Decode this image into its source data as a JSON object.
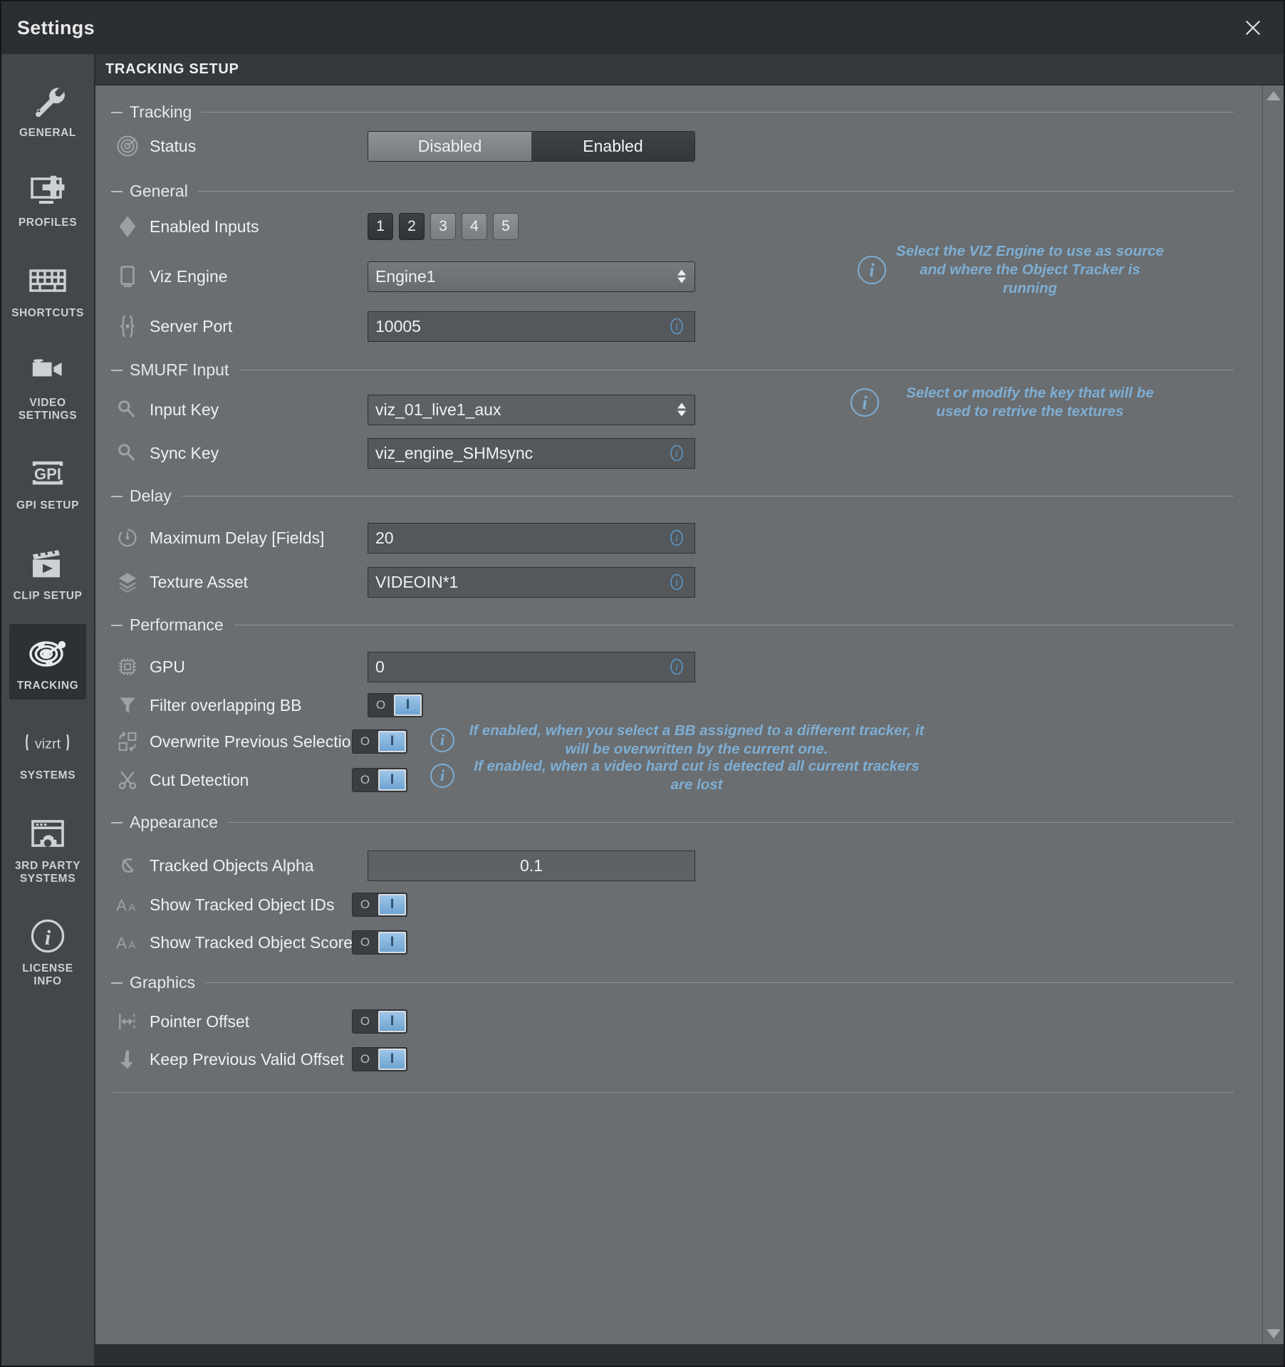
{
  "window": {
    "title": "Settings",
    "close_icon": "close-icon"
  },
  "sidebar": {
    "items": [
      {
        "label": "GENERAL",
        "icon": "wrench-icon",
        "active": false
      },
      {
        "label": "PROFILES",
        "icon": "monitor-gear-icon",
        "active": false
      },
      {
        "label": "SHORTCUTS",
        "icon": "keyboard-icon",
        "active": false
      },
      {
        "label": "VIDEO SETTINGS",
        "icon": "video-camera-icon",
        "active": false
      },
      {
        "label": "GPI SETUP",
        "icon": "gpi-icon",
        "active": false
      },
      {
        "label": "CLIP SETUP",
        "icon": "clapperboard-icon",
        "active": false
      },
      {
        "label": "TRACKING",
        "icon": "radar-target-icon",
        "active": true
      },
      {
        "label": "SYSTEMS",
        "icon": "vizrt-logo-icon",
        "active": false
      },
      {
        "label": "3RD PARTY SYSTEMS",
        "icon": "window-gear-icon",
        "active": false
      },
      {
        "label": "LICENSE INFO",
        "icon": "info-circle-icon",
        "active": false
      }
    ]
  },
  "panel": {
    "title": "TRACKING SETUP"
  },
  "groups": {
    "tracking": "Tracking",
    "general": "General",
    "smurf_input": "SMURF Input",
    "delay": "Delay",
    "performance": "Performance",
    "appearance": "Appearance",
    "graphics": "Graphics"
  },
  "fields": {
    "status": {
      "label": "Status",
      "icon": "radar-target-icon",
      "options": [
        "Disabled",
        "Enabled"
      ],
      "selected": "Enabled"
    },
    "enabled_inputs": {
      "label": "Enabled Inputs",
      "icon": "tag-icon",
      "options": [
        "1",
        "2",
        "3",
        "4",
        "5"
      ],
      "selected": [
        "1",
        "2"
      ]
    },
    "viz_engine": {
      "label": "Viz Engine",
      "icon": "monitor-icon",
      "value": "Engine1",
      "hint": "Select the VIZ Engine to use as source and where the Object Tracker is running"
    },
    "server_port": {
      "label": "Server Port",
      "icon": "braces-icon",
      "value": "10005"
    },
    "input_key": {
      "label": "Input Key",
      "icon": "key-icon",
      "value": "viz_01_live1_aux",
      "selected_text": true,
      "hint": "Select or modify the key that will be used to retrive the textures"
    },
    "sync_key": {
      "label": "Sync Key",
      "icon": "key-icon",
      "value": "viz_engine_SHMsync"
    },
    "maximum_delay": {
      "label": "Maximum Delay [Fields]",
      "icon": "stopwatch-icon",
      "value": "20"
    },
    "texture_asset": {
      "label": "Texture Asset",
      "icon": "layers-icon",
      "value": "VIDEOIN*1"
    },
    "gpu": {
      "label": "GPU",
      "icon": "chip-icon",
      "value": "0"
    },
    "filter_overlapping_bb": {
      "label": "Filter overlapping BB",
      "icon": "funnel-icon",
      "toggle": {
        "off_label": "O",
        "on_label": "I",
        "state": "on"
      }
    },
    "overwrite_previous_selection": {
      "label": "Overwrite Previous Selection",
      "icon": "swap-squares-icon",
      "toggle": {
        "off_label": "O",
        "on_label": "I",
        "state": "on"
      },
      "hint": "If enabled, when you select a BB assigned to a different tracker, it will be overwritten by the current one."
    },
    "cut_detection": {
      "label": "Cut Detection",
      "icon": "scissors-icon",
      "toggle": {
        "off_label": "O",
        "on_label": "I",
        "state": "on"
      },
      "hint": "If enabled, when a video hard cut is detected all current trackers are lost"
    },
    "tracked_objects_alpha": {
      "label": "Tracked Objects Alpha",
      "icon": "alpha-icon",
      "value": "0.1"
    },
    "show_tracked_object_ids": {
      "label": "Show Tracked Object IDs",
      "icon": "text-size-icon",
      "toggle": {
        "off_label": "O",
        "on_label": "I",
        "state": "on"
      }
    },
    "show_tracked_object_scores": {
      "label": "Show Tracked Object Scores",
      "icon": "text-size-icon",
      "toggle": {
        "off_label": "O",
        "on_label": "I",
        "state": "on"
      }
    },
    "pointer_offset": {
      "label": "Pointer Offset",
      "icon": "horizontal-offset-icon",
      "toggle": {
        "off_label": "O",
        "on_label": "I",
        "state": "on"
      }
    },
    "keep_previous_valid_offset": {
      "label": "Keep Previous Valid Offset",
      "icon": "arrow-down-icon",
      "toggle": {
        "off_label": "O",
        "on_label": "I",
        "state": "on"
      }
    }
  },
  "colors": {
    "accent_blue": "#7eaed3",
    "panel_bg": "#6a6e71",
    "sidebar_bg": "#434749",
    "titlebar_bg": "#2b2e32",
    "selection_blue": "#3f6f96"
  }
}
